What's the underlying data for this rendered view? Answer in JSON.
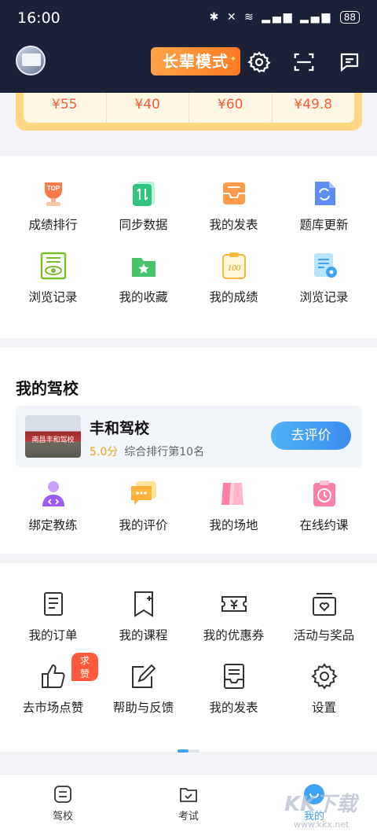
{
  "status_bar": {
    "time": "16:00",
    "battery": "88"
  },
  "header": {
    "elder_mode_label": "长辈模式"
  },
  "prices": [
    "¥55",
    "¥40",
    "¥60",
    "¥49.8"
  ],
  "grid1": [
    {
      "label": "成绩排行",
      "icon": "trophy-icon"
    },
    {
      "label": "同步数据",
      "icon": "sync-data-icon"
    },
    {
      "label": "我的发表",
      "icon": "inbox-icon"
    },
    {
      "label": "题库更新",
      "icon": "refresh-doc-icon"
    },
    {
      "label": "浏览记录",
      "icon": "eye-doc-icon"
    },
    {
      "label": "我的收藏",
      "icon": "star-folder-icon"
    },
    {
      "label": "我的成绩",
      "icon": "score-board-icon"
    },
    {
      "label": "浏览记录",
      "icon": "view-record-icon"
    }
  ],
  "school_section": {
    "title": "我的驾校",
    "school_name": "丰和驾校",
    "score": "5.0分",
    "rank_text": "综合排行第10名",
    "review_button": "去评价",
    "photo_sign": "南昌丰和驾校"
  },
  "grid2": [
    {
      "label": "绑定教练",
      "icon": "coach-icon"
    },
    {
      "label": "我的评价",
      "icon": "comment-icon"
    },
    {
      "label": "我的场地",
      "icon": "field-icon"
    },
    {
      "label": "在线约课",
      "icon": "clock-book-icon"
    }
  ],
  "grid3": [
    {
      "label": "我的订单",
      "icon": "order-icon"
    },
    {
      "label": "我的课程",
      "icon": "course-icon"
    },
    {
      "label": "我的优惠券",
      "icon": "coupon-icon"
    },
    {
      "label": "活动与奖品",
      "icon": "gift-icon"
    },
    {
      "label": "去市场点赞",
      "icon": "thumb-up-icon",
      "badge": "求赞"
    },
    {
      "label": "帮助与反馈",
      "icon": "feedback-icon"
    },
    {
      "label": "我的发表",
      "icon": "publish-icon"
    },
    {
      "label": "设置",
      "icon": "settings-icon"
    }
  ],
  "tabs": [
    {
      "label": "驾校",
      "icon": "school-tab-icon"
    },
    {
      "label": "考试",
      "icon": "exam-tab-icon"
    },
    {
      "label": "我的",
      "icon": "mine-tab-icon"
    }
  ],
  "watermark": {
    "text": "KK下载",
    "url": "www.kkx.net"
  },
  "colors": {
    "accent": "#3c8cf0",
    "price": "#ff5a36",
    "header_bg": "#1b2136",
    "elder_mode": "#ff8a2a"
  }
}
